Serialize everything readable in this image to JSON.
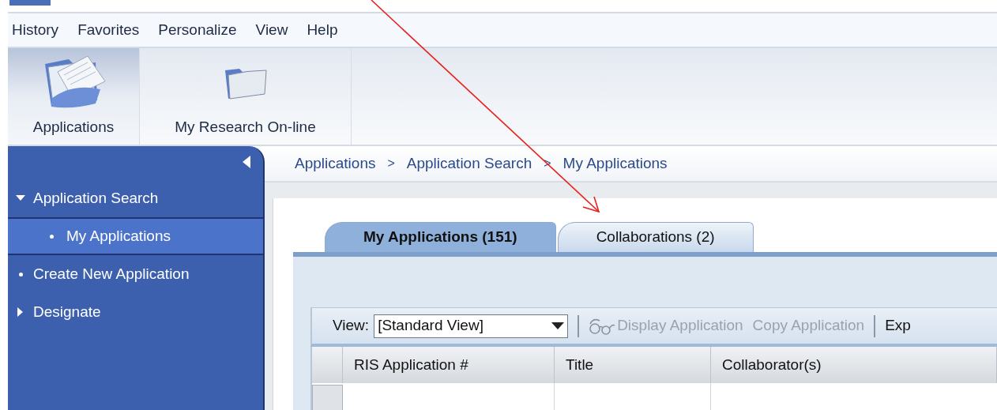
{
  "menu_bar": [
    "History",
    "Favorites",
    "Personalize",
    "View",
    "Help"
  ],
  "launchpad": [
    {
      "label": "Applications",
      "selected": true,
      "kind": "documents"
    },
    {
      "label": "My Research On-line",
      "selected": false,
      "kind": "folder"
    }
  ],
  "sidebar": {
    "items": [
      {
        "label": "Application Search",
        "kind": "folder",
        "expanded": true,
        "selected": false,
        "children": [
          {
            "label": "My Applications",
            "kind": "leaf",
            "selected": true
          }
        ]
      },
      {
        "label": "Create New Application",
        "kind": "leaf",
        "selected": false
      },
      {
        "label": "Designate",
        "kind": "folder",
        "expanded": false,
        "selected": false
      }
    ]
  },
  "breadcrumb": [
    {
      "kind": "link",
      "text": "Applications"
    },
    {
      "kind": "separator",
      "text": ">"
    },
    {
      "kind": "link",
      "text": "Application Search"
    },
    {
      "kind": "separator",
      "text": ">"
    },
    {
      "kind": "link",
      "text": "My Applications"
    }
  ],
  "tabs": [
    {
      "label": "My Applications (151)",
      "selected": true
    },
    {
      "label": "Collaborations (2)",
      "selected": false
    }
  ],
  "table_toolbar": {
    "view_label": "View:",
    "view_value": "[Standard View]",
    "items": [
      {
        "kind": "separator"
      },
      {
        "kind": "icon_button",
        "label": "Display Application",
        "disabled": true
      },
      {
        "kind": "button",
        "label": "Copy Application",
        "disabled": true
      },
      {
        "kind": "separator"
      },
      {
        "kind": "button",
        "label": "Exp",
        "disabled": false
      }
    ]
  },
  "table": {
    "columns": [
      "RIS Application #",
      "Title",
      "Collaborator(s)"
    ]
  }
}
